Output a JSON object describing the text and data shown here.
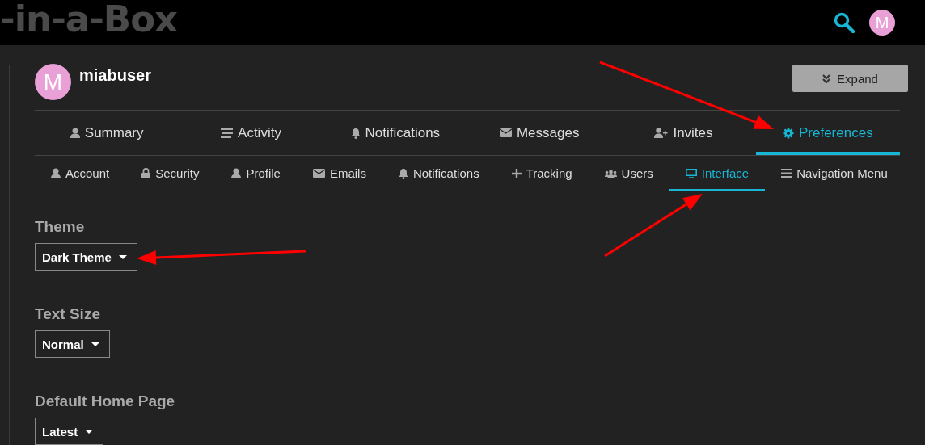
{
  "header": {
    "logo": "-in-a-Box",
    "avatar": "M"
  },
  "profile": {
    "avatar": "M",
    "username": "miabuser",
    "expand_button": "Expand"
  },
  "main_tabs": [
    {
      "label": "Summary",
      "selected": false
    },
    {
      "label": "Activity",
      "selected": false
    },
    {
      "label": "Notifications",
      "selected": false
    },
    {
      "label": "Messages",
      "selected": false
    },
    {
      "label": "Invites",
      "selected": false
    },
    {
      "label": "Preferences",
      "selected": true
    }
  ],
  "sub_tabs": [
    {
      "label": "Account",
      "selected": false
    },
    {
      "label": "Security",
      "selected": false
    },
    {
      "label": "Profile",
      "selected": false
    },
    {
      "label": "Emails",
      "selected": false
    },
    {
      "label": "Notifications",
      "selected": false
    },
    {
      "label": "Tracking",
      "selected": false
    },
    {
      "label": "Users",
      "selected": false
    },
    {
      "label": "Interface",
      "selected": true
    },
    {
      "label": "Navigation Menu",
      "selected": false
    }
  ],
  "settings": [
    {
      "label": "Theme",
      "value": "Dark Theme"
    },
    {
      "label": "Text Size",
      "value": "Normal"
    },
    {
      "label": "Default Home Page",
      "value": "Latest"
    }
  ]
}
